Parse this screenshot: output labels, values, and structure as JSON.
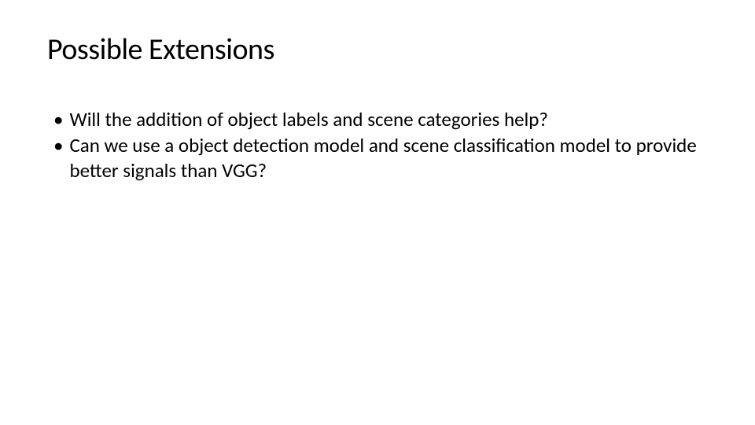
{
  "slide": {
    "title": "Possible Extensions",
    "bullets": [
      {
        "text": "Will the addition of object labels and scene categories help?"
      },
      {
        "text": "Can we use a object detection model and scene classification model to provide better signals than VGG?"
      }
    ]
  }
}
